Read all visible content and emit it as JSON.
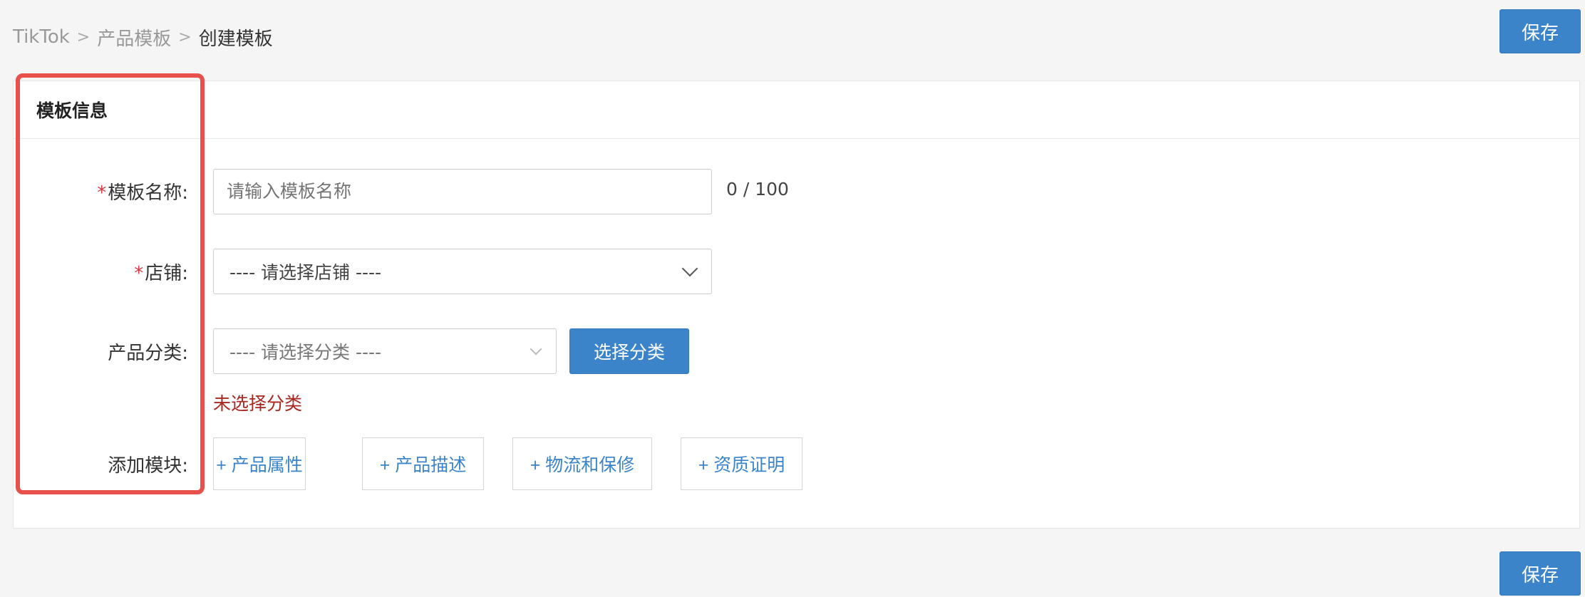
{
  "breadcrumb": {
    "items": [
      "TikTok",
      "产品模板",
      "创建模板"
    ],
    "separator": ">"
  },
  "toolbar": {
    "save_label_top": "保存",
    "save_label_bottom": "保存"
  },
  "card": {
    "title": "模板信息"
  },
  "form": {
    "template_name": {
      "required_mark": "*",
      "label": "模板名称:",
      "placeholder": "请输入模板名称",
      "value": "",
      "counter": "0 / 100"
    },
    "store": {
      "required_mark": "*",
      "label": "店铺:",
      "selected": "---- 请选择店铺 ----"
    },
    "category": {
      "label": "产品分类:",
      "selected": "---- 请选择分类 ----",
      "choose_button": "选择分类",
      "error": "未选择分类"
    },
    "modules": {
      "label": "添加模块:",
      "buttons": [
        "+ 产品属性",
        "+ 产品描述",
        "+ 物流和保修",
        "+ 资质证明"
      ]
    }
  },
  "colors": {
    "primary": "#3b84c9",
    "error": "#a8271f",
    "required": "#d9363e",
    "highlight_border": "#e8514b"
  }
}
